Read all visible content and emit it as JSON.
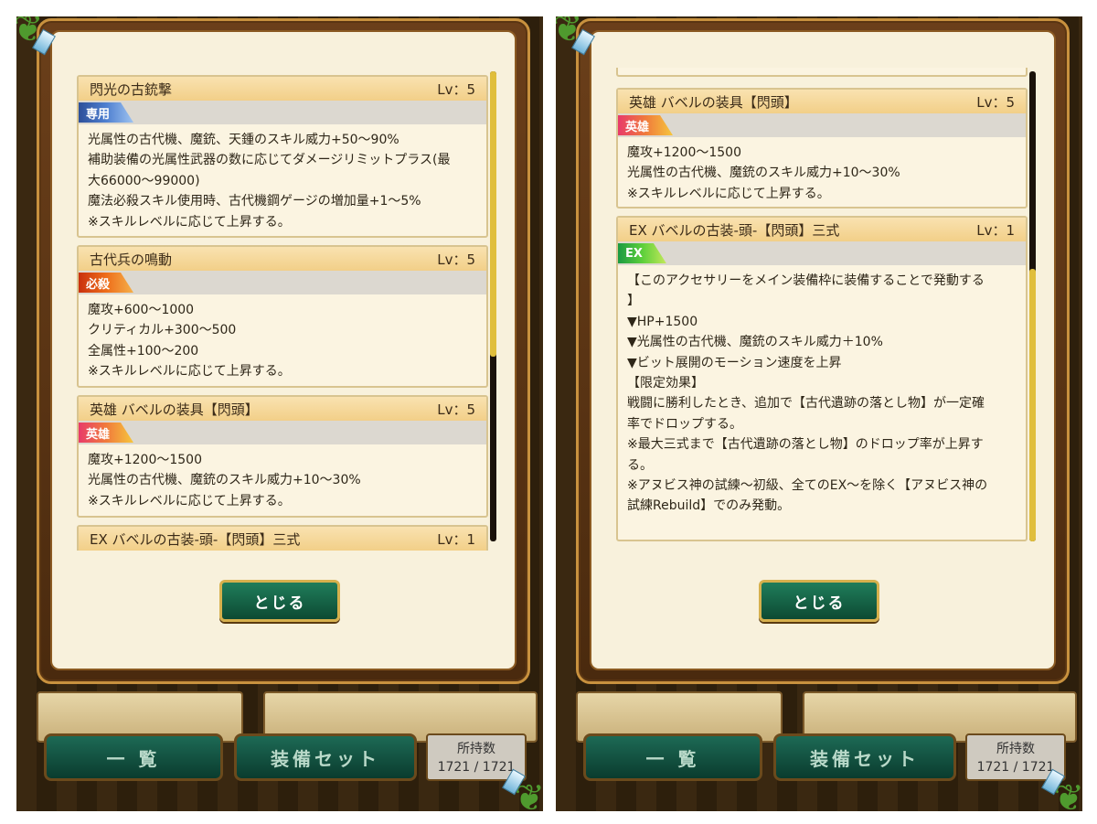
{
  "left": {
    "cards": [
      {
        "title": "閃光の古銃撃",
        "level": "Lv：5",
        "tag": "専用",
        "lines": [
          "光属性の古代機、魔銃、天鍾のスキル威力+50〜90%",
          "補助装備の光属性武器の数に応じてダメージリミットプラス(最",
          "大66000〜99000)",
          "魔法必殺スキル使用時、古代機鋼ゲージの増加量+1〜5%",
          "※スキルレベルに応じて上昇する。"
        ]
      },
      {
        "title": "古代兵の鳴動",
        "level": "Lv：5",
        "tag": "必殺",
        "lines": [
          "魔攻+600〜1000",
          "クリティカル+300〜500",
          "全属性+100〜200",
          "※スキルレベルに応じて上昇する。"
        ]
      },
      {
        "title": "英雄 バベルの装具【閃頭】",
        "level": "Lv：5",
        "tag": "英雄",
        "lines": [
          "魔攻+1200〜1500",
          "光属性の古代機、魔銃のスキル威力+10〜30%",
          "※スキルレベルに応じて上昇する。"
        ]
      },
      {
        "title": "EX バベルの古装-頭-【閃頭】三式",
        "level": "Lv：1"
      }
    ]
  },
  "right": {
    "cards": [
      {
        "title": "英雄 バベルの装具【閃頭】",
        "level": "Lv：5",
        "tag": "英雄",
        "lines": [
          "魔攻+1200〜1500",
          "光属性の古代機、魔銃のスキル威力+10〜30%",
          "※スキルレベルに応じて上昇する。"
        ]
      },
      {
        "title": "EX バベルの古装-頭-【閃頭】三式",
        "level": "Lv：1",
        "tag": "EX",
        "lines": [
          "【このアクセサリーをメイン装備枠に装備することで発動する",
          "】",
          "▼HP+1500",
          "▼光属性の古代機、魔銃のスキル威力＋10%",
          "▼ビット展開のモーション速度を上昇",
          "",
          "【限定効果】",
          "戦闘に勝利したとき、追加で【古代遺跡の落とし物】が一定確",
          "率でドロップする。",
          "※最大三式まで【古代遺跡の落とし物】のドロップ率が上昇す",
          "る。",
          "※アヌビス神の試練〜初級、全てのEX〜を除く【アヌビス神の",
          "試練Rebuild】でのみ発動。"
        ]
      }
    ]
  },
  "close_label": "とじる",
  "nav": {
    "list_label": "一 覧",
    "equip_set_label": "装備セット",
    "count_label": "所持数",
    "count_value": "1721 / 1721"
  },
  "icons": {
    "corner_vine": "vine-icon",
    "corner_gem": "crystal-icon"
  }
}
